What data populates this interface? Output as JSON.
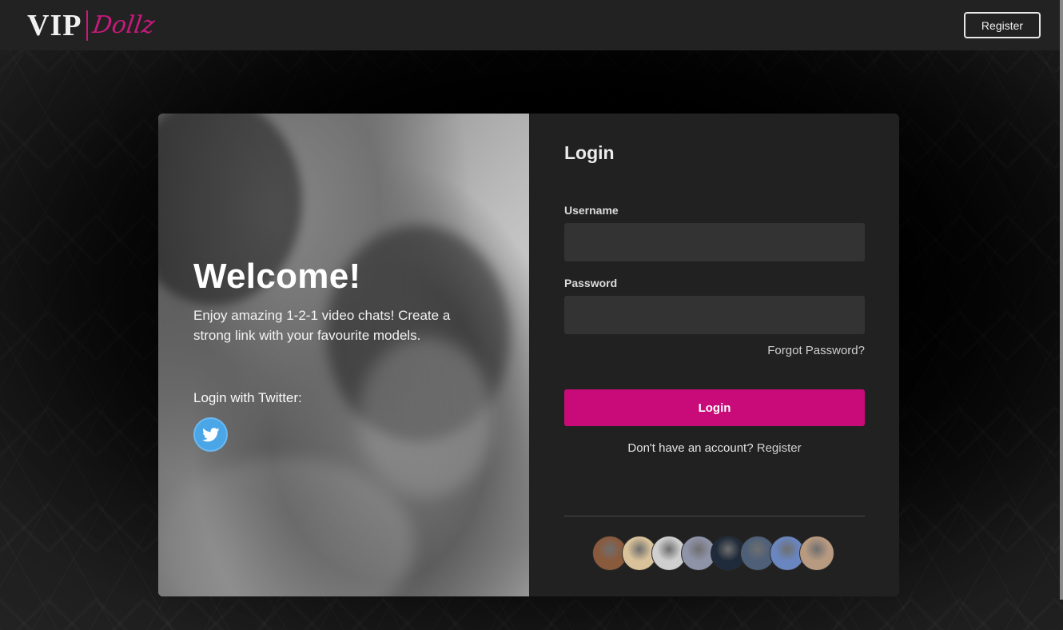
{
  "header": {
    "logo_vip": "VIP",
    "logo_dollz": "Dollz",
    "register_label": "Register"
  },
  "hero": {
    "welcome": "Welcome!",
    "tagline": "Enjoy amazing 1-2-1 video chats! Create a strong link with your favourite models.",
    "twitter_label": "Login with Twitter:"
  },
  "login": {
    "title": "Login",
    "username_label": "Username",
    "username_value": "",
    "password_label": "Password",
    "password_value": "",
    "forgot_label": "Forgot Password?",
    "button_label": "Login",
    "signup_prompt": "Don't have an account?",
    "signup_link": "Register"
  },
  "avatars": [
    {
      "name": "model-1",
      "color": "#8a5a3c"
    },
    {
      "name": "model-2",
      "color": "#d9c29a"
    },
    {
      "name": "model-3",
      "color": "#cfcfcf"
    },
    {
      "name": "model-4",
      "color": "#8f93a8"
    },
    {
      "name": "model-5",
      "color": "#1f2a3a"
    },
    {
      "name": "model-6",
      "color": "#4e5f78"
    },
    {
      "name": "model-7",
      "color": "#6a86c0"
    },
    {
      "name": "model-8",
      "color": "#b89a80"
    }
  ],
  "colors": {
    "accent": "#c80b78",
    "twitter": "#4ba6e8"
  }
}
